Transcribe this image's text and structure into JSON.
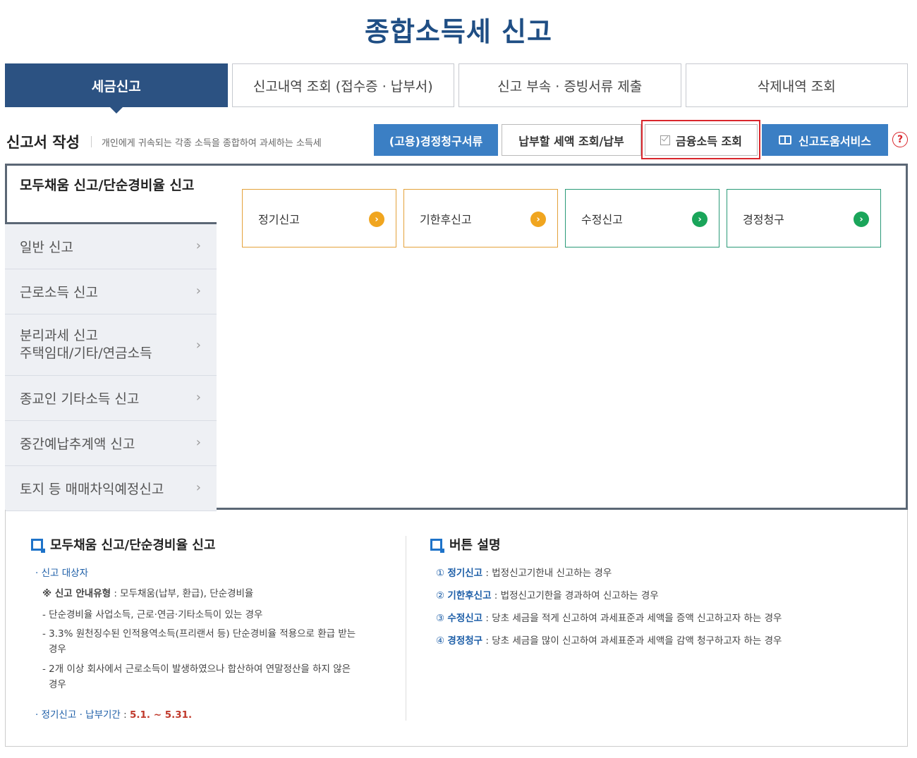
{
  "page_title": "종합소득세 신고",
  "main_tabs": [
    {
      "label": "세금신고",
      "active": true
    },
    {
      "label": "신고내역 조회 (접수증 · 납부서)",
      "active": false
    },
    {
      "label": "신고 부속 · 증빙서류 제출",
      "active": false
    },
    {
      "label": "삭제내역 조회",
      "active": false
    }
  ],
  "section": {
    "title": "신고서 작성",
    "desc": "개인에게 귀속되는 각종 소득을 종합하여 과세하는 소득세"
  },
  "actions": {
    "refund_docs": "(고용)경정청구서류",
    "tax_due": "납부할 세액 조회/납부",
    "finance_income": "금융소득 조회",
    "help_service": "신고도움서비스",
    "help_icon": "?"
  },
  "side_menu": {
    "active": "모두채움 신고/단순경비율 신고",
    "items": [
      {
        "label": "일반 신고"
      },
      {
        "label": "근로소득 신고"
      },
      {
        "label": "분리과세 신고",
        "label2": "주택임대/기타/연금소득"
      },
      {
        "label": "종교인 기타소득 신고"
      },
      {
        "label": "중간예납추계액 신고"
      },
      {
        "label": "토지 등 매매차익예정신고"
      }
    ],
    "chevron": "›"
  },
  "report_types": [
    {
      "label": "정기신고",
      "color": "#f0a51f"
    },
    {
      "label": "기한후신고",
      "color": "#f0a51f"
    },
    {
      "label": "수정신고",
      "color": "#1aa55a"
    },
    {
      "label": "경정청구",
      "color": "#1aa55a"
    }
  ],
  "info_left": {
    "title": "모두채움 신고/단순경비율 신고",
    "target_label": "신고 대상자",
    "guide_label": "※ 신고 안내유형",
    "guide_value": " : 모두채움(납부, 환급), 단순경비율",
    "lines": [
      "- 단순경비율 사업소득, 근로·연금·기타소득이 있는 경우",
      "- 3.3% 원천징수된 인적용역소득(프리랜서 등) 단순경비율 적용으로 환급 받는",
      "경우",
      "- 2개 이상 회사에서 근로소득이 발생하였으나 합산하여 연말정산을 하지 않은",
      "경우"
    ],
    "period_label": "정기신고 · 납부기간",
    "period_sep": " : ",
    "period_value": "5.1. ~ 5.31."
  },
  "info_right": {
    "title": "버튼 설명",
    "items": [
      {
        "num": "①",
        "label": "정기신고",
        "desc": " : 법정신고기한내 신고하는 경우"
      },
      {
        "num": "②",
        "label": "기한후신고",
        "desc": " : 법정신고기한을 경과하여 신고하는 경우"
      },
      {
        "num": "③",
        "label": "수정신고",
        "desc": " : 당초 세금을 적게 신고하여 과세표준과 세액을 증액 신고하고자 하는 경우"
      },
      {
        "num": "④",
        "label": "경정청구",
        "desc": " : 당초 세금을 많이 신고하여 과세표준과 세액을 감액 청구하고자 하는 경우"
      }
    ]
  }
}
